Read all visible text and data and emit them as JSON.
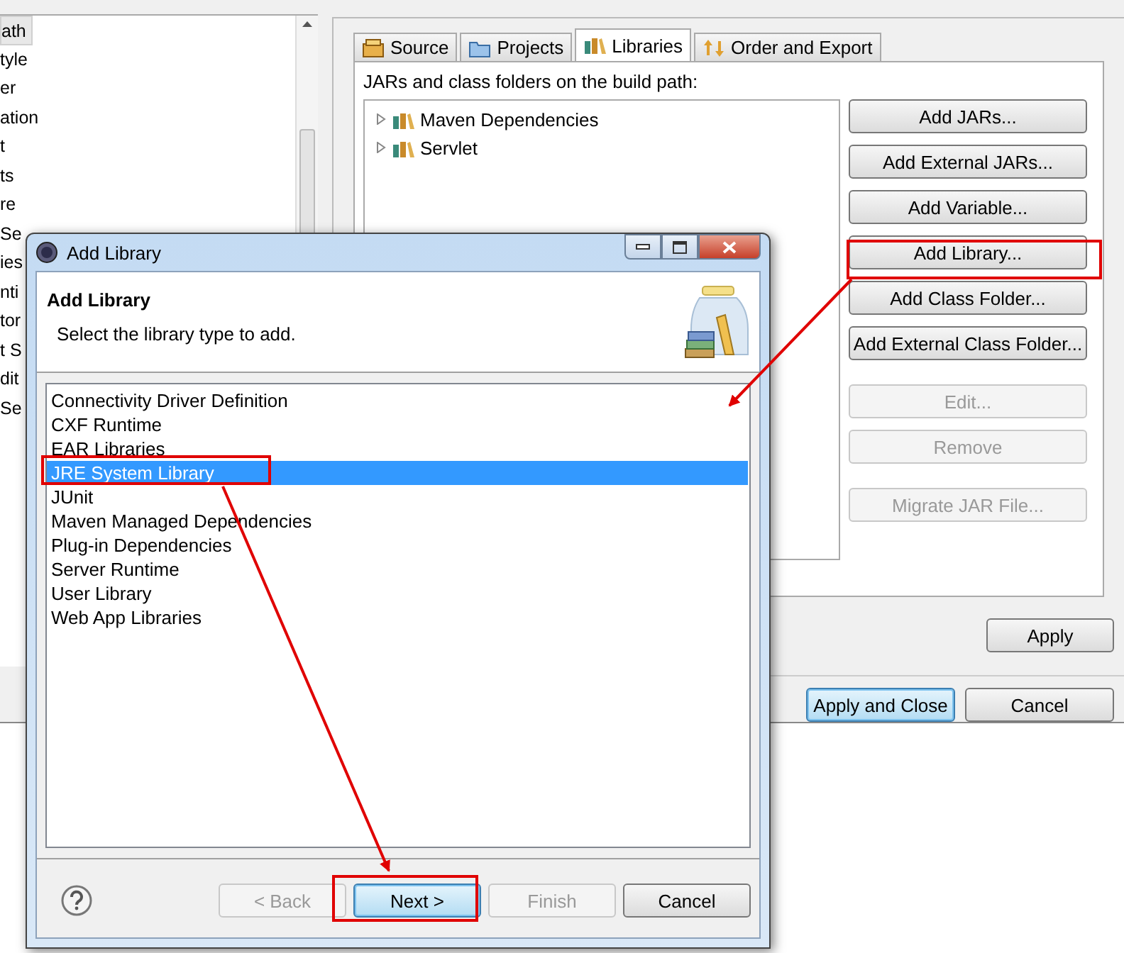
{
  "background_window": {
    "sidebar": {
      "items": [
        {
          "label": "ath",
          "selected": true
        },
        {
          "label": "tyle",
          "selected": false
        },
        {
          "label": "er",
          "selected": false
        },
        {
          "label": "ation",
          "selected": false
        },
        {
          "label": "t",
          "selected": false
        },
        {
          "label": "ts",
          "selected": false
        },
        {
          "label": "re",
          "selected": false
        },
        {
          "label": "Se",
          "selected": false
        },
        {
          "label": "ies",
          "selected": false
        },
        {
          "label": "nti",
          "selected": false
        },
        {
          "label": "tor",
          "selected": false
        },
        {
          "label": "t S",
          "selected": false
        },
        {
          "label": "dit",
          "selected": false
        },
        {
          "label": "Se",
          "selected": false
        }
      ]
    },
    "tabs": [
      {
        "label": "Source",
        "selected": false
      },
      {
        "label": "Projects",
        "selected": false
      },
      {
        "label": "Libraries",
        "selected": true
      },
      {
        "label": "Order and Export",
        "selected": false
      }
    ],
    "build_path_label": "JARs and class folders on the build path:",
    "entries": [
      {
        "label": "Maven Dependencies",
        "expanded": false
      },
      {
        "label": "Servlet",
        "expanded": false
      }
    ],
    "buttons": [
      {
        "label": "Add JARs...",
        "disabled": false
      },
      {
        "label": "Add External JARs...",
        "disabled": false
      },
      {
        "label": "Add Variable...",
        "disabled": false
      },
      {
        "label": "Add Library...",
        "disabled": false
      },
      {
        "label": "Add Class Folder...",
        "disabled": false
      },
      {
        "label": "Add External Class Folder...",
        "disabled": false
      },
      {
        "label": "Edit...",
        "disabled": true
      },
      {
        "label": "Remove",
        "disabled": true
      },
      {
        "label": "Migrate JAR File...",
        "disabled": true
      }
    ],
    "apply_button": "Apply",
    "footer_buttons": [
      {
        "label": "Apply and Close",
        "default": true
      },
      {
        "label": "Cancel",
        "default": false
      }
    ]
  },
  "dialog": {
    "title": "Add Library",
    "heading": "Add Library",
    "description": "Select the library type to add.",
    "library_types": [
      {
        "label": "Connectivity Driver Definition",
        "selected": false
      },
      {
        "label": "CXF Runtime",
        "selected": false
      },
      {
        "label": "EAR Libraries",
        "selected": false
      },
      {
        "label": "JRE System Library",
        "selected": true
      },
      {
        "label": "JUnit",
        "selected": false
      },
      {
        "label": "Maven Managed Dependencies",
        "selected": false
      },
      {
        "label": "Plug-in Dependencies",
        "selected": false
      },
      {
        "label": "Server Runtime",
        "selected": false
      },
      {
        "label": "User Library",
        "selected": false
      },
      {
        "label": "Web App Libraries",
        "selected": false
      }
    ],
    "buttons": [
      {
        "label": "< Back",
        "disabled": true,
        "default": false
      },
      {
        "label": "Next >",
        "disabled": false,
        "default": true
      },
      {
        "label": "Finish",
        "disabled": true,
        "default": false
      },
      {
        "label": "Cancel",
        "disabled": false,
        "default": false
      }
    ]
  }
}
